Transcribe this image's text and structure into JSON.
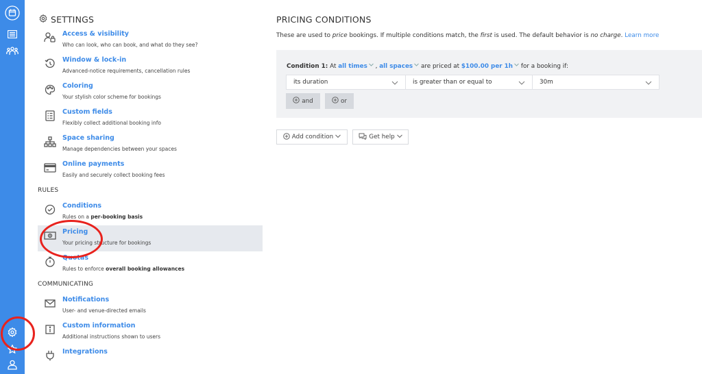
{
  "rail": {
    "top_icons": [
      "calendar-icon",
      "list-icon",
      "users-icon"
    ],
    "bottom_icons": [
      "gear-icon",
      "star-icon",
      "user-icon"
    ]
  },
  "settings": {
    "title": "SETTINGS",
    "general_items": [
      {
        "icon": "user-lock-icon",
        "title": "Access & visibility",
        "desc": "Who can look, who can book, and what do they see?"
      },
      {
        "icon": "history-icon",
        "title": "Window & lock-in",
        "desc": "Advanced-notice requirements, cancellation rules"
      },
      {
        "icon": "palette-icon",
        "title": "Coloring",
        "desc": "Your stylish color scheme for bookings"
      },
      {
        "icon": "form-icon",
        "title": "Custom fields",
        "desc": "Flexibly collect additional booking info"
      },
      {
        "icon": "hierarchy-icon",
        "title": "Space sharing",
        "desc": "Manage dependencies between your spaces"
      },
      {
        "icon": "credit-card-icon",
        "title": "Online payments",
        "desc": "Easily and securely collect booking fees"
      }
    ],
    "rules_label": "RULES",
    "rules_items": [
      {
        "icon": "check-badge-icon",
        "title": "Conditions",
        "desc_pre": "Rules on a ",
        "desc_bold": "per-booking basis",
        "desc_post": ""
      },
      {
        "icon": "money-icon",
        "title": "Pricing",
        "desc_pre": "Your pricing structure for bookings",
        "desc_bold": "",
        "desc_post": "",
        "active": true
      },
      {
        "icon": "stopwatch-icon",
        "title": "Quotas",
        "desc_pre": "Rules to enforce ",
        "desc_bold": "overall booking allowances",
        "desc_post": ""
      }
    ],
    "communicating_label": "COMMUNICATING",
    "communicating_items": [
      {
        "icon": "envelope-icon",
        "title": "Notifications",
        "desc": "User- and venue-directed emails"
      },
      {
        "icon": "info-icon",
        "title": "Custom information",
        "desc": "Additional instructions shown to users"
      },
      {
        "icon": "plug-icon",
        "title": "Integrations",
        "desc": ""
      }
    ]
  },
  "main": {
    "title": "PRICING CONDITIONS",
    "intro": {
      "p1": "These are used to ",
      "i1": "price",
      "p2": " bookings. If multiple conditions match, the ",
      "i2": "first",
      "p3": " is used. The default behavior is ",
      "i3": "no charge",
      "p4": ". ",
      "link": "Learn more"
    },
    "condition": {
      "label": "Condition 1:",
      "at": " At ",
      "times": "all times",
      "comma": " , ",
      "spaces": "all spaces",
      "priced": " are priced at ",
      "price": "$100.00 per 1h",
      "tail": " for a booking if:",
      "field": "its duration",
      "operator": "is greater than or equal to",
      "value": "30m",
      "and_label": "and",
      "or_label": "or"
    },
    "add_condition": "Add condition",
    "get_help": "Get help"
  },
  "colors": {
    "accent": "#3d8be8",
    "annotation": "#e8221d",
    "active_bg": "#e6e9ee",
    "panel_bg": "#f1f2f4"
  }
}
